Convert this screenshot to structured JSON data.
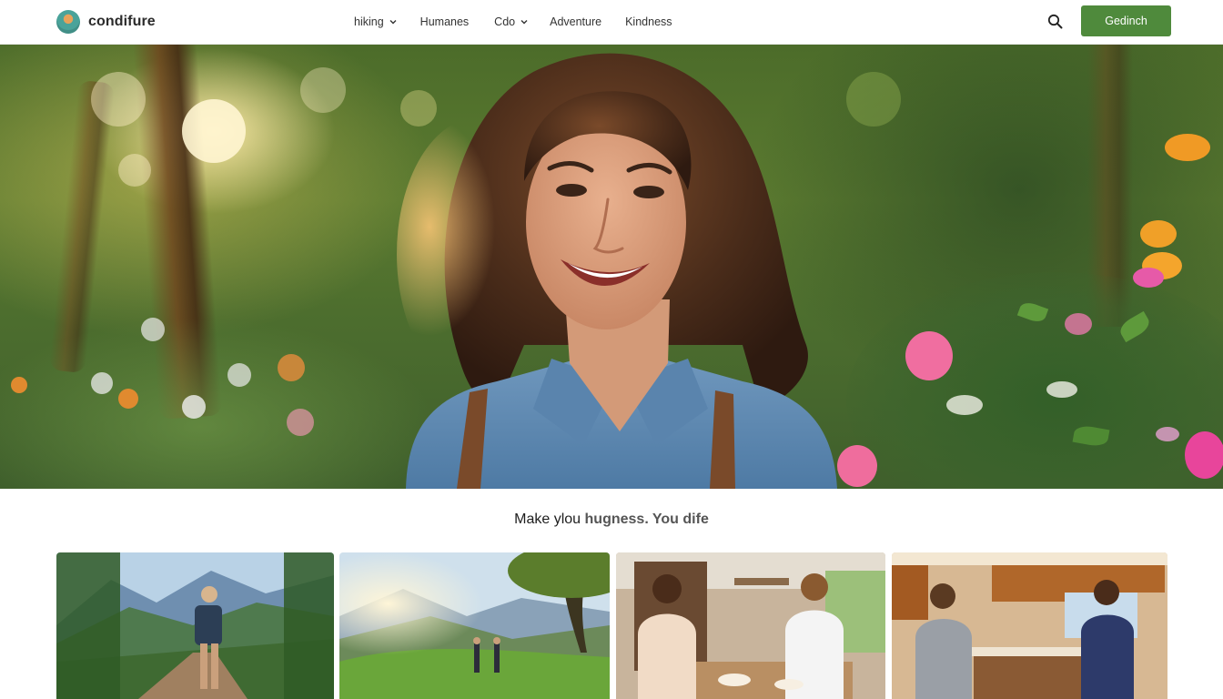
{
  "nav": {
    "brand": "condifure",
    "menu": [
      {
        "label": "hiking",
        "dropdown": true
      },
      {
        "label": "Humanes",
        "dropdown": false
      },
      {
        "label": "Cdo",
        "dropdown": true
      },
      {
        "label": "Adventure",
        "dropdown": false
      },
      {
        "label": "Kindness",
        "dropdown": false
      }
    ],
    "cta_label": "Gedinch",
    "search_icon": "magnifier-icon"
  },
  "colors": {
    "accent": "#4f8a3c",
    "text": "#222222",
    "nav_bg": "#ffffff"
  },
  "hero": {
    "subject": "smiling-woman-in-garden"
  },
  "tagline": {
    "lead": "Make ylou",
    "rest": "hugness. You dife"
  },
  "gallery": [
    {
      "subject": "hiker-on-mountain-trail"
    },
    {
      "subject": "couple-in-green-valley"
    },
    {
      "subject": "friends-dining-in-kitchen"
    },
    {
      "subject": "women-cooking-in-kitchen"
    }
  ]
}
